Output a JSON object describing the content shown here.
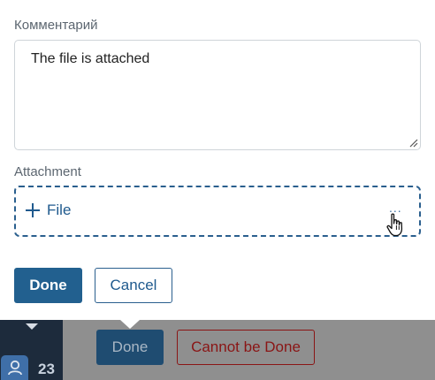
{
  "comment": {
    "label": "Комментарий",
    "value": "The file is attached"
  },
  "attachment": {
    "label": "Attachment",
    "add_file_label": "File",
    "more_label": "..."
  },
  "actions": {
    "done_label": "Done",
    "cancel_label": "Cancel"
  },
  "background": {
    "done_label": "Done",
    "cannot_label": "Cannot be Done",
    "counter": "23"
  },
  "colors": {
    "primary": "#22608f",
    "danger": "#8a1515",
    "sidebar": "#1d2b3c"
  }
}
